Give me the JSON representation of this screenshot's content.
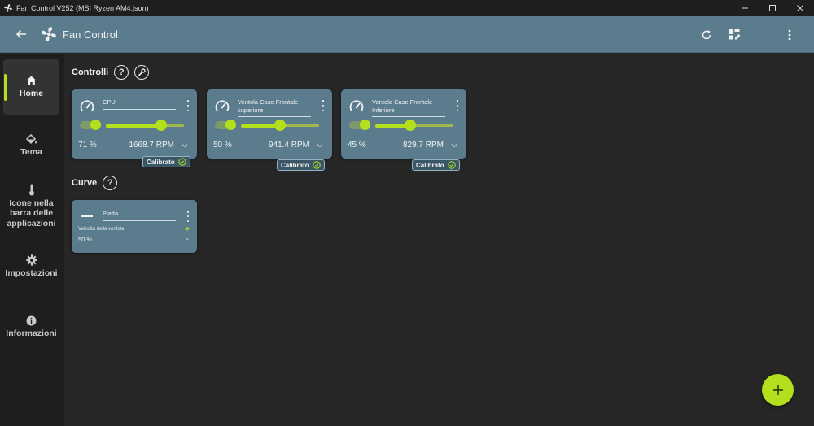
{
  "window": {
    "title": "Fan Control V252 (MSI Ryzen AM4.json)",
    "minimize_icon": "minimize-icon",
    "maximize_icon": "maximize-icon",
    "close_icon": "close-icon"
  },
  "appbar": {
    "title": "Fan Control",
    "icons": [
      "back-arrow-icon",
      "fan-logo-icon",
      "refresh-icon",
      "dashboard-edit-icon",
      "more-vert-icon"
    ]
  },
  "sidebar": {
    "items": [
      {
        "label": "Home",
        "icon": "home-icon",
        "active": true
      },
      {
        "label": "Tema",
        "icon": "paint-bucket-icon",
        "active": false
      },
      {
        "label": "Icone nella barra delle applicazioni",
        "icon": "thermometer-icon",
        "active": false
      },
      {
        "label": "Impostazioni",
        "icon": "gear-icon",
        "active": false
      },
      {
        "label": "Informazioni",
        "icon": "info-icon",
        "active": false
      }
    ]
  },
  "sections": {
    "controls": {
      "title": "Controlli",
      "help_icon": "help-icon",
      "tools_icon": "wrench-icon"
    },
    "curves": {
      "title": "Curve",
      "help_icon": "help-icon"
    }
  },
  "controls": [
    {
      "name": "CPU",
      "percent_label": "71 %",
      "percent": 71,
      "rpm": "1668.7 RPM",
      "enabled": true,
      "badge": "Calibrato"
    },
    {
      "name": "Ventola Case Frontale superiore",
      "percent_label": "50 %",
      "percent": 50,
      "rpm": "941.4 RPM",
      "enabled": true,
      "badge": "Calibrato"
    },
    {
      "name": "Ventola Case Frontale Inferiore",
      "percent_label": "45 %",
      "percent": 45,
      "rpm": "829.7 RPM",
      "enabled": true,
      "badge": "Calibrato"
    }
  ],
  "curves": [
    {
      "name": "Piatta",
      "field_label": "Velocità della ventola",
      "value": "50 %",
      "increment": "+",
      "decrement": "-"
    }
  ],
  "fab": {
    "label": "+"
  },
  "colors": {
    "accent": "#b2e01c",
    "card": "#5b7c8c",
    "background": "#262626",
    "sidebar": "#1e1e1e"
  }
}
